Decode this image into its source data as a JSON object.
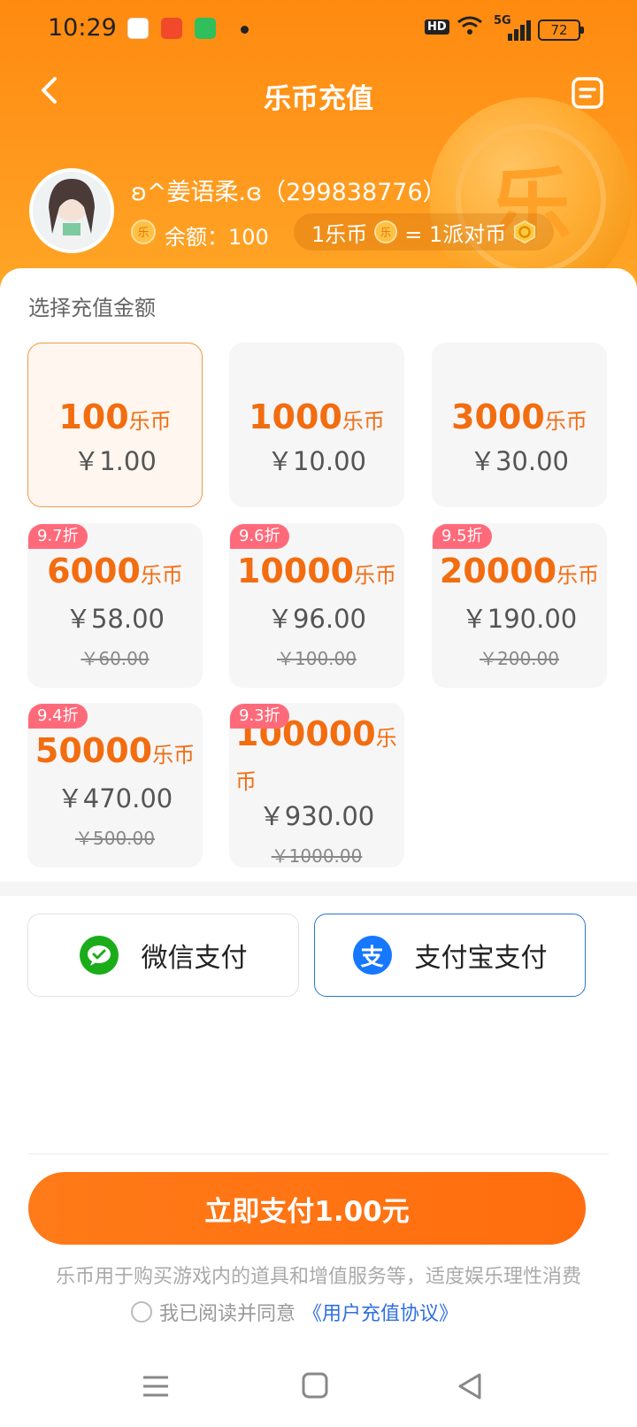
{
  "status_bar": {
    "time": "10:29",
    "battery": "72",
    "network": "5G",
    "hd": "HD"
  },
  "header": {
    "title": "乐币充值",
    "back_icon": "chevron-left-icon",
    "record_icon": "record-list-icon"
  },
  "user": {
    "name": "ʚ^姜语柔.ɞ（299838776）",
    "balance_label": "余额：100",
    "rate_left": "1乐币",
    "rate_right": "= 1派对币"
  },
  "packages": {
    "section_label": "选择充值金额",
    "items": [
      {
        "amount": "100",
        "unit": "乐币",
        "price": "￥1.00",
        "original": "",
        "discount": ""
      },
      {
        "amount": "1000",
        "unit": "乐币",
        "price": "￥10.00",
        "original": "",
        "discount": ""
      },
      {
        "amount": "3000",
        "unit": "乐币",
        "price": "￥30.00",
        "original": "",
        "discount": ""
      },
      {
        "amount": "6000",
        "unit": "乐币",
        "price": "￥58.00",
        "original": "￥60.00",
        "discount": "9.7折"
      },
      {
        "amount": "10000",
        "unit": "乐币",
        "price": "￥96.00",
        "original": "￥100.00",
        "discount": "9.6折"
      },
      {
        "amount": "20000",
        "unit": "乐币",
        "price": "￥190.00",
        "original": "￥200.00",
        "discount": "9.5折"
      },
      {
        "amount": "50000",
        "unit": "乐币",
        "price": "￥470.00",
        "original": "￥500.00",
        "discount": "9.4折"
      },
      {
        "amount": "100000",
        "unit": "乐币",
        "price": "￥930.00",
        "original": "￥1000.00",
        "discount": "9.3折"
      }
    ]
  },
  "payment": {
    "wechat": "微信支付",
    "alipay": "支付宝支付",
    "selected": "alipay"
  },
  "submit": {
    "label": "立即支付1.00元"
  },
  "footer": {
    "note": "乐币用于购买游戏内的道具和增值服务等，适度娱乐理性消费",
    "agree_text": "我已阅读并同意",
    "agreement_link": "《用户充值协议》"
  },
  "colors": {
    "brand_orange": "#ff7a18",
    "discount_tag": "#ff6a7a",
    "alipay_blue": "#1677ff",
    "wechat_green": "#1aad19"
  }
}
